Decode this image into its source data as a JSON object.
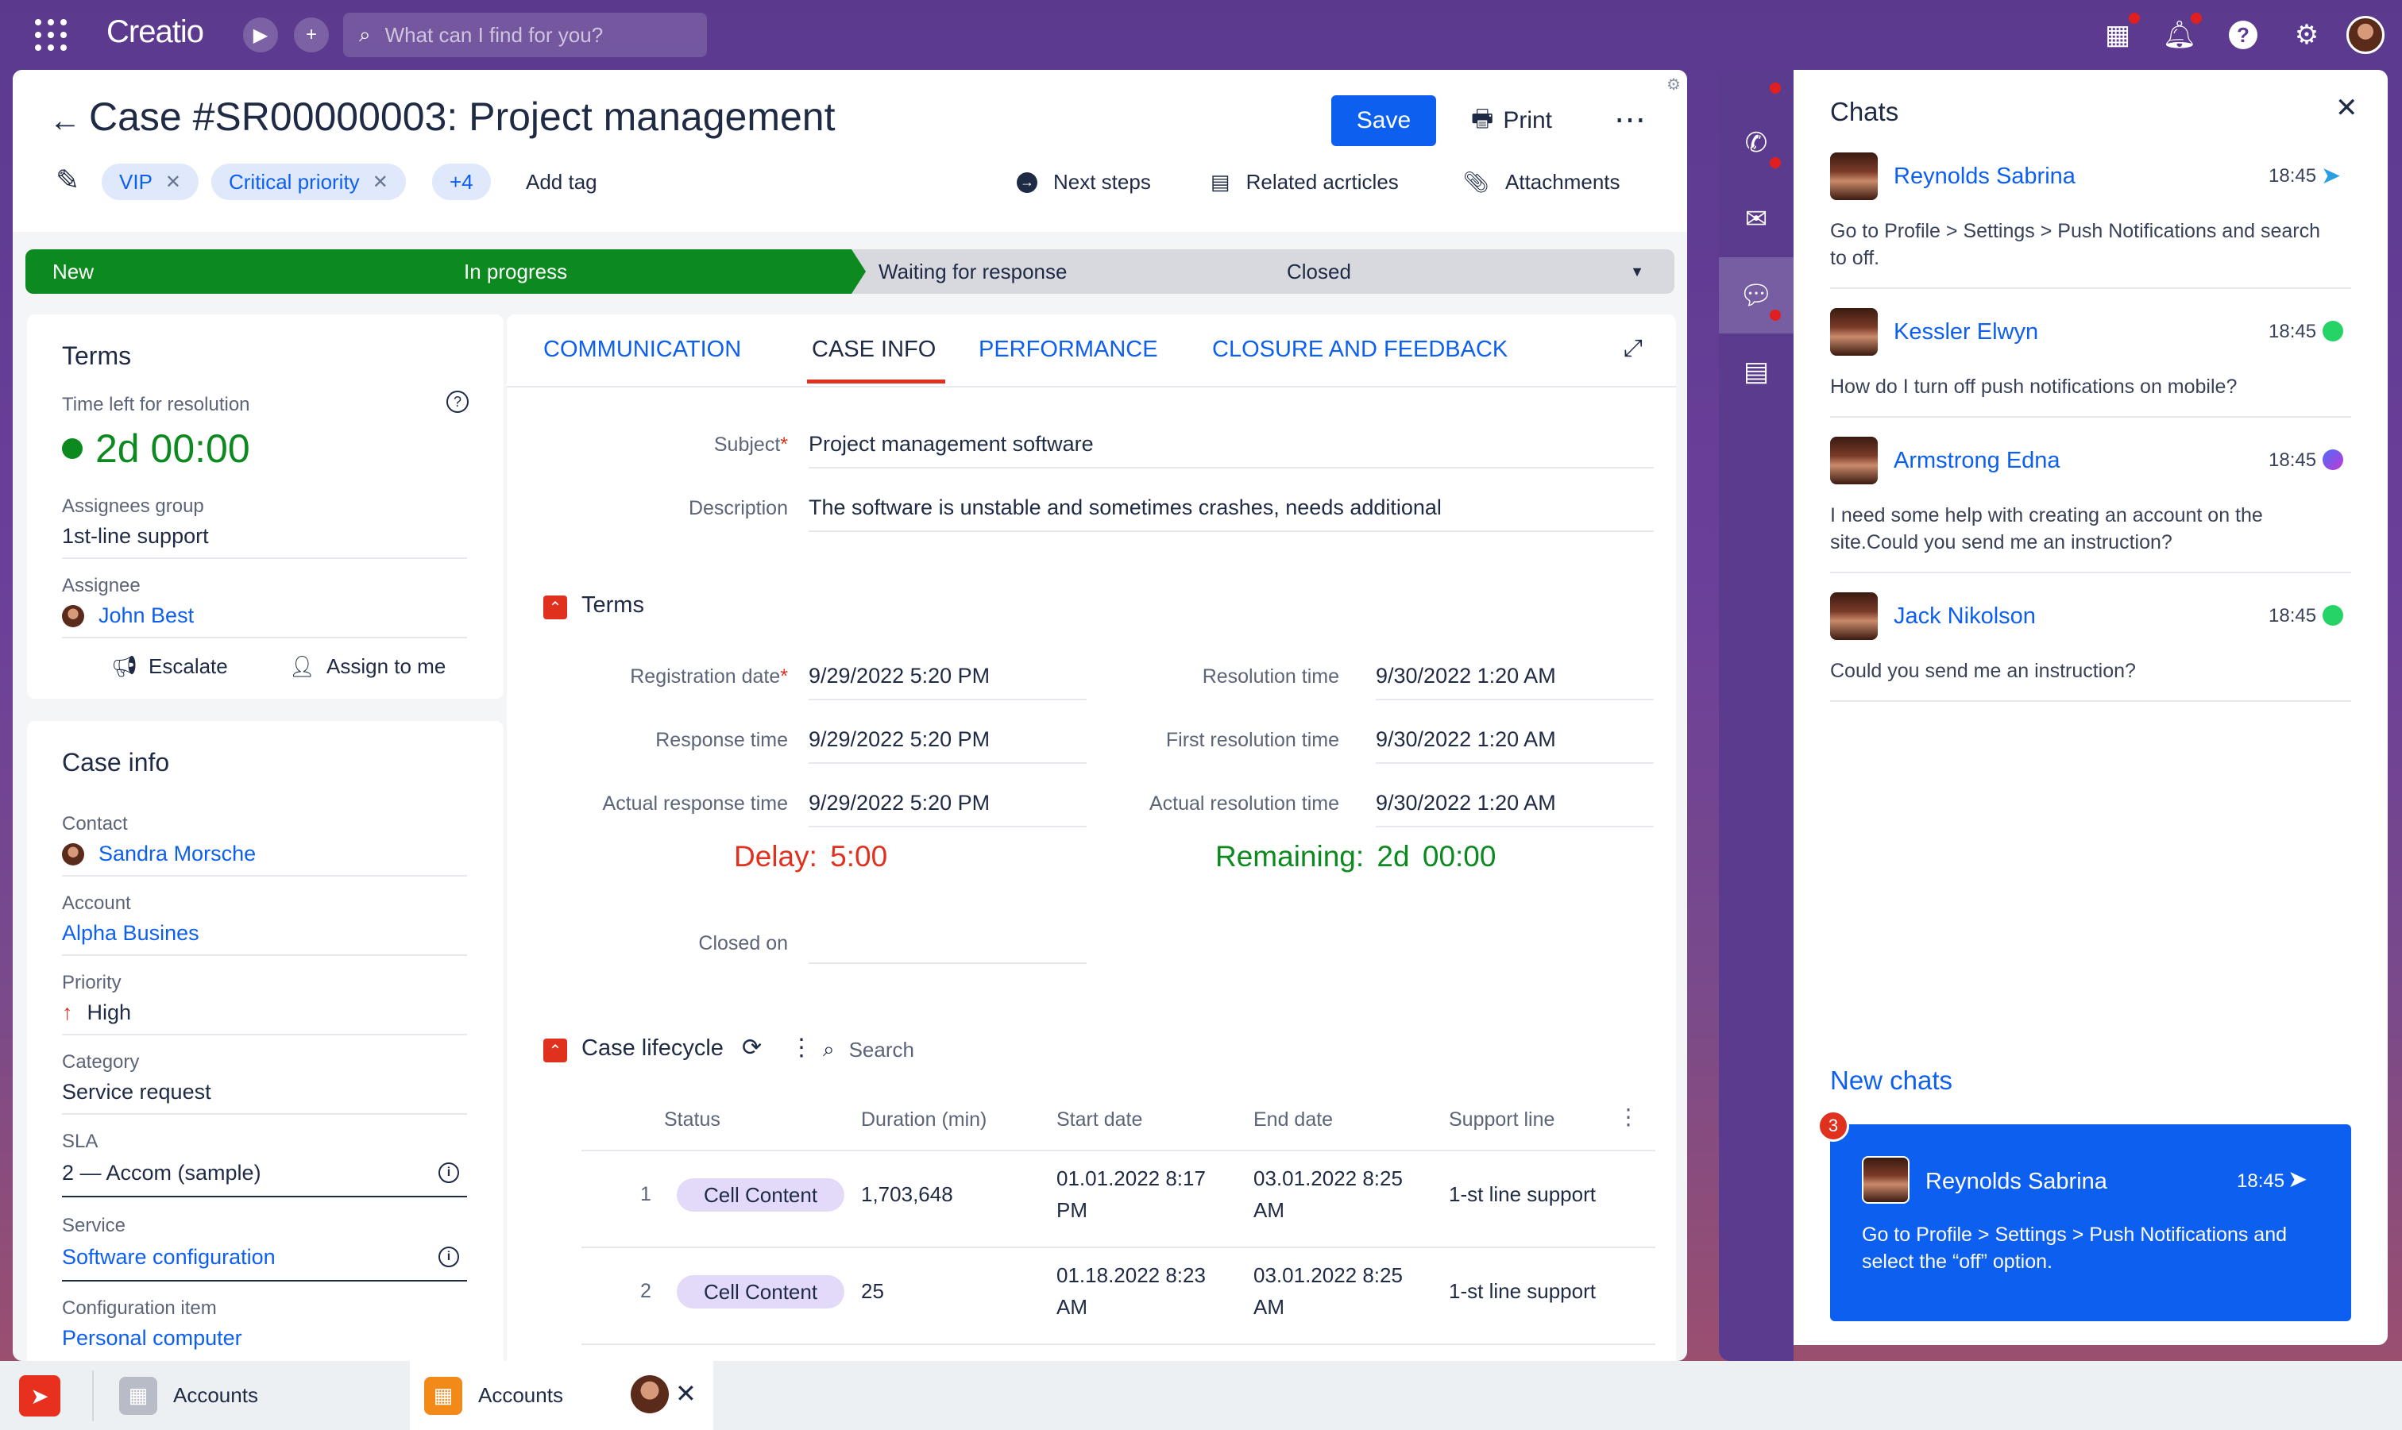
{
  "app": {
    "logo": "Creatio",
    "search_placeholder": "What can I find for you?"
  },
  "header": {
    "title": "Case #SR00000003: Project management",
    "save_label": "Save",
    "print_label": "Print",
    "tags": [
      "VIP",
      "Critical priority",
      "+4"
    ],
    "add_tag": "Add tag",
    "links": [
      "Next steps",
      "Related acrticles",
      "Attachments"
    ]
  },
  "stages": [
    "New",
    "In progress",
    "Waiting for response",
    "Closed"
  ],
  "terms_panel": {
    "title": "Terms",
    "time_left_label": "Time left for resolution",
    "time_left_value": "2d 00:00",
    "assignees_group_label": "Assignees group",
    "assignees_group_value": "1st-line support",
    "assignee_label": "Assignee",
    "assignee_value": "John Best",
    "escalate": "Escalate",
    "assign_to_me": "Assign to me"
  },
  "case_info_panel": {
    "title": "Case info",
    "contact_label": "Contact",
    "contact_value": "Sandra Morsche",
    "account_label": "Account",
    "account_value": "Alpha Busines",
    "priority_label": "Priority",
    "priority_value": "High",
    "category_label": "Category",
    "category_value": "Service request",
    "sla_label": "SLA",
    "sla_value": "2 — Accom (sample)",
    "service_label": "Service",
    "service_value": "Software configuration",
    "config_label": "Configuration item",
    "config_value": "Personal computer"
  },
  "tabs": [
    "COMMUNICATION",
    "CASE INFO",
    "PERFORMANCE",
    "CLOSURE AND FEEDBACK"
  ],
  "case_info": {
    "subject_label": "Subject",
    "subject_value": "Project management software",
    "description_label": "Description",
    "description_value": "The software is unstable and sometimes crashes, needs additional",
    "terms_title": "Terms",
    "registration_date_label": "Registration date",
    "registration_date_value": "9/29/2022 5:20 PM",
    "response_time_label": "Response time",
    "response_time_value": "9/29/2022 5:20 PM",
    "actual_response_label": "Actual response time",
    "actual_response_value": "9/29/2022 5:20 PM",
    "resolution_time_label": "Resolution time",
    "resolution_time_value": "9/30/2022 1:20 AM",
    "first_resolution_label": "First resolution time",
    "first_resolution_value": "9/30/2022 1:20 AM",
    "actual_resolution_label": "Actual resolution time",
    "actual_resolution_value": "9/30/2022 1:20 AM",
    "delay": "Delay: 5:00",
    "remaining": "Remaining: 2d 00:00",
    "closed_on_label": "Closed on",
    "lifecycle_title": "Case lifecycle",
    "lifecycle_search": "Search",
    "columns": [
      "Status",
      "Duration (min)",
      "Start date",
      "End date",
      "Support line"
    ],
    "rows": [
      {
        "num": "1",
        "status": "Cell Content",
        "duration": "1,703,648",
        "start_1": "01.01.2022 8:17",
        "start_2": "PM",
        "end_1": "03.01.2022 8:25",
        "end_2": "AM",
        "support": "1-st line support"
      },
      {
        "num": "2",
        "status": "Cell Content",
        "duration": "25",
        "start_1": "01.18.2022 8:23",
        "start_2": "AM",
        "end_1": "03.01.2022 8:25",
        "end_2": "AM",
        "support": "1-st line support"
      }
    ]
  },
  "chats": {
    "title": "Chats",
    "items": [
      {
        "name": "Reynolds Sabrina",
        "time": "18:45",
        "msg": "Go to Profile > Settings > Push Notifications and search to off.",
        "channel": "telegram-icon"
      },
      {
        "name": "Kessler Elwyn",
        "time": "18:45",
        "msg": "How do I turn off push notifications on mobile?",
        "channel": "whatsapp-icon"
      },
      {
        "name": "Armstrong Edna",
        "time": "18:45",
        "msg": "I need some help with creating an account on the site.Could you send me an instruction?",
        "channel": "messenger-icon"
      },
      {
        "name": "Jack Nikolson",
        "time": "18:45",
        "msg": "Could you send me an instruction?",
        "channel": "whatsapp-icon"
      }
    ],
    "new_chats_title": "New chats",
    "new_chat": {
      "badge": "3",
      "name": "Reynolds Sabrina",
      "time": "18:45",
      "msg": "Go to Profile > Settings > Push Notifications and select the “off” option."
    }
  },
  "bottom_tabs": [
    "Accounts",
    "Accounts"
  ],
  "colors": {
    "accent": "#0d5ff0",
    "green": "#0d8a1f",
    "red": "#e0301e",
    "purple": "#5a3b8e"
  }
}
